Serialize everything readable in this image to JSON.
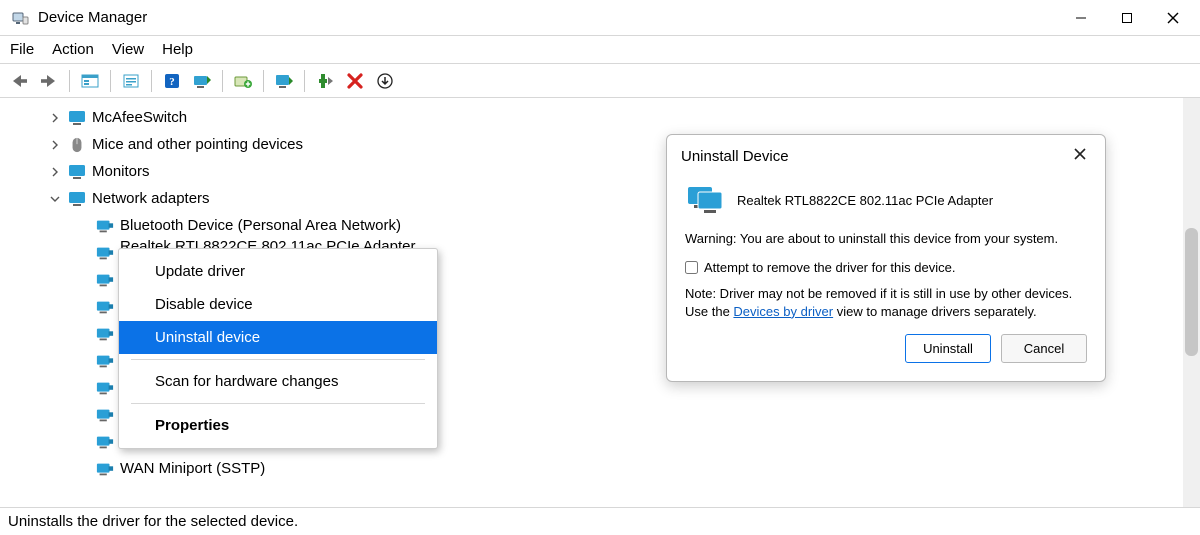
{
  "app": {
    "title": "Device Manager"
  },
  "menubar": {
    "items": [
      "File",
      "Action",
      "View",
      "Help"
    ]
  },
  "tree": {
    "nodes": [
      {
        "expanded": false,
        "level": 1,
        "icon": "monitor",
        "label": "McAfeeSwitch"
      },
      {
        "expanded": false,
        "level": 1,
        "icon": "mouse",
        "label": "Mice and other pointing devices"
      },
      {
        "expanded": false,
        "level": 1,
        "icon": "monitor",
        "label": "Monitors"
      },
      {
        "expanded": true,
        "level": 1,
        "icon": "monitor",
        "label": "Network adapters"
      },
      {
        "expanded": null,
        "level": 2,
        "icon": "netcard",
        "label": "Bluetooth Device (Personal Area Network)"
      },
      {
        "expanded": null,
        "level": 2,
        "icon": "netcard",
        "label": "Realtek RTL8822CE 802.11ac PCIe Adapter",
        "selected": true,
        "partial": true
      },
      {
        "expanded": null,
        "level": 2,
        "icon": "netcard",
        "label": "",
        "hidden_label": true
      },
      {
        "expanded": null,
        "level": 2,
        "icon": "netcard",
        "label": "",
        "hidden_label": true
      },
      {
        "expanded": null,
        "level": 2,
        "icon": "netcard",
        "label": "",
        "hidden_label": true
      },
      {
        "expanded": null,
        "level": 2,
        "icon": "netcard",
        "label": "",
        "hidden_label": true
      },
      {
        "expanded": null,
        "level": 2,
        "icon": "netcard",
        "label": "",
        "hidden_label": true
      },
      {
        "expanded": null,
        "level": 2,
        "icon": "netcard",
        "label": "",
        "hidden_label": true
      },
      {
        "expanded": null,
        "level": 2,
        "icon": "netcard",
        "label": "",
        "hidden_label": true
      },
      {
        "expanded": null,
        "level": 2,
        "icon": "netcard",
        "label": "WAN Miniport (SSTP)"
      }
    ]
  },
  "context_menu": {
    "items": [
      {
        "label": "Update driver"
      },
      {
        "label": "Disable device"
      },
      {
        "label": "Uninstall device",
        "hovered": true
      },
      {
        "sep": true
      },
      {
        "label": "Scan for hardware changes"
      },
      {
        "sep": true
      },
      {
        "label": "Properties",
        "bold": true
      }
    ]
  },
  "dialog": {
    "title": "Uninstall Device",
    "device": "Realtek RTL8822CE 802.11ac PCIe Adapter",
    "warning": "Warning: You are about to uninstall this device from your system.",
    "checkbox_label": "Attempt to remove the driver for this device.",
    "note_prefix": "Note: Driver may not be removed if it is still in use by other devices. Use the ",
    "note_link": "Devices by driver",
    "note_suffix": " view to manage drivers separately.",
    "btn_primary": "Uninstall",
    "btn_cancel": "Cancel"
  },
  "statusbar": {
    "text": "Uninstalls the driver for the selected device."
  }
}
